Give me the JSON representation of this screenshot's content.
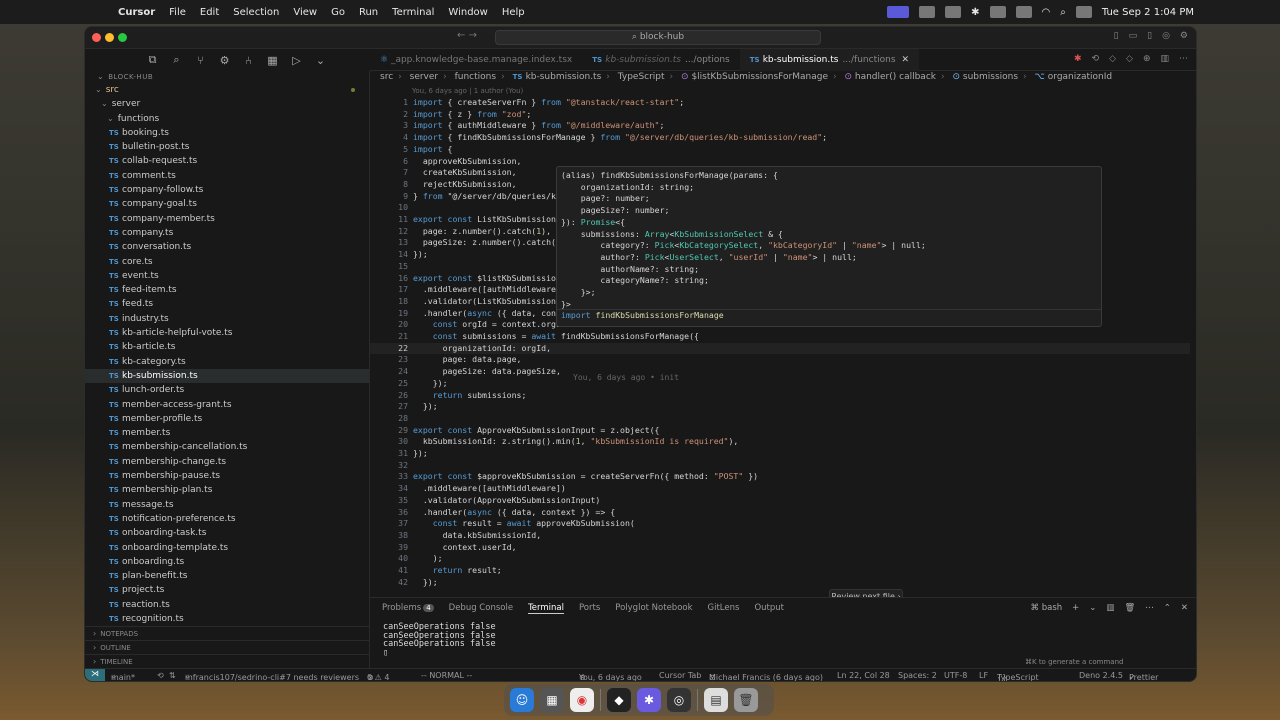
{
  "menubar": {
    "app": "Cursor",
    "items": [
      "File",
      "Edit",
      "Selection",
      "View",
      "Go",
      "Run",
      "Terminal",
      "Window",
      "Help"
    ],
    "datetime": "Tue Sep 2  1:04 PM"
  },
  "window": {
    "search": "block-hub"
  },
  "explorer": {
    "section": "BLOCK-HUB",
    "folder_src": "src",
    "folder_server": "server",
    "folder_functions": "functions",
    "files": [
      "booking.ts",
      "bulletin-post.ts",
      "collab-request.ts",
      "comment.ts",
      "company-follow.ts",
      "company-goal.ts",
      "company-member.ts",
      "company.ts",
      "conversation.ts",
      "core.ts",
      "event.ts",
      "feed-item.ts",
      "feed.ts",
      "industry.ts",
      "kb-article-helpful-vote.ts",
      "kb-article.ts",
      "kb-category.ts",
      "kb-submission.ts",
      "lunch-order.ts",
      "member-access-grant.ts",
      "member-profile.ts",
      "member.ts",
      "membership-cancellation.ts",
      "membership-change.ts",
      "membership-pause.ts",
      "membership-plan.ts",
      "message.ts",
      "notification-preference.ts",
      "onboarding-task.ts",
      "onboarding-template.ts",
      "onboarding.ts",
      "plan-benefit.ts",
      "project.ts",
      "reaction.ts",
      "recognition.ts"
    ],
    "selected": "kb-submission.ts",
    "notepads": "NOTEPADS",
    "outline": "OUTLINE",
    "timeline": "TIMELINE"
  },
  "tabs": [
    {
      "label": "_app.knowledge-base.manage.index.tsx",
      "sub": "",
      "active": false
    },
    {
      "label": "kb-submission.ts",
      "sub": ".../options",
      "active": false
    },
    {
      "label": "kb-submission.ts",
      "sub": ".../functions",
      "active": true
    }
  ],
  "breadcrumb": [
    "src",
    "server",
    "functions",
    "kb-submission.ts",
    "TypeScript",
    "$listKbSubmissionsForManage",
    "handler() callback",
    "submissions",
    "organizationId"
  ],
  "blame_top": "You, 6 days ago | 1 author (You)",
  "code": [
    {
      "n": "1",
      "t": "import { createServerFn } from \"@tanstack/react-start\";"
    },
    {
      "n": "2",
      "t": "import { z } from \"zod\";"
    },
    {
      "n": "3",
      "t": "import { authMiddleware } from \"@/middleware/auth\";"
    },
    {
      "n": "4",
      "t": "import { findKbSubmissionsForManage } from \"@/server/db/queries/kb-submission/read\";"
    },
    {
      "n": "5",
      "t": "import {"
    },
    {
      "n": "6",
      "t": "  approveKbSubmission,"
    },
    {
      "n": "7",
      "t": "  createKbSubmission,"
    },
    {
      "n": "8",
      "t": "  rejectKbSubmission,"
    },
    {
      "n": "9",
      "t": "} from \"@/server/db/queries/kb"
    },
    {
      "n": "10",
      "t": ""
    },
    {
      "n": "11",
      "t": "export const ListKbSubmissions"
    },
    {
      "n": "12",
      "t": "  page: z.number().catch(1),"
    },
    {
      "n": "13",
      "t": "  pageSize: z.number().catch(5"
    },
    {
      "n": "14",
      "t": "});"
    },
    {
      "n": "15",
      "t": ""
    },
    {
      "n": "16",
      "t": "export const $listKbSubmission"
    },
    {
      "n": "17",
      "t": "  .middleware([authMiddleware]"
    },
    {
      "n": "18",
      "t": "  .validator(ListKbSubmissions"
    },
    {
      "n": "19",
      "t": "  .handler(async ({ data, cont"
    },
    {
      "n": "20",
      "t": "    const orgId = context.orgI"
    },
    {
      "n": "21",
      "t": "    const submissions = await findKbSubmissionsForManage({"
    },
    {
      "n": "22",
      "t": "      organizationId: orgId,"
    },
    {
      "n": "23",
      "t": "      page: data.page,"
    },
    {
      "n": "24",
      "t": "      pageSize: data.pageSize,"
    },
    {
      "n": "25",
      "t": "    });"
    },
    {
      "n": "26",
      "t": "    return submissions;"
    },
    {
      "n": "27",
      "t": "  });"
    },
    {
      "n": "28",
      "t": ""
    },
    {
      "n": "29",
      "t": "export const ApproveKbSubmissionInput = z.object({"
    },
    {
      "n": "30",
      "t": "  kbSubmissionId: z.string().min(1, \"kbSubmissionId is required\"),"
    },
    {
      "n": "31",
      "t": "});"
    },
    {
      "n": "32",
      "t": ""
    },
    {
      "n": "33",
      "t": "export const $approveKbSubmission = createServerFn({ method: \"POST\" })"
    },
    {
      "n": "34",
      "t": "  .middleware([authMiddleware])"
    },
    {
      "n": "35",
      "t": "  .validator(ApproveKbSubmissionInput)"
    },
    {
      "n": "36",
      "t": "  .handler(async ({ data, context }) => {"
    },
    {
      "n": "37",
      "t": "    const result = await approveKbSubmission("
    },
    {
      "n": "38",
      "t": "      data.kbSubmissionId,"
    },
    {
      "n": "39",
      "t": "      context.userId,"
    },
    {
      "n": "40",
      "t": "    );"
    },
    {
      "n": "41",
      "t": "    return result;"
    },
    {
      "n": "42",
      "t": "  });"
    }
  ],
  "current_line": "22",
  "inline_blame": "You, 6 days ago • init",
  "hover": {
    "lines": [
      "(alias) findKbSubmissionsForManage(params: {",
      "    organizationId: string;",
      "    page?: number;",
      "    pageSize?: number;",
      "}): Promise<{",
      "    submissions: Array<KbSubmissionSelect & {",
      "        category?: Pick<KbCategorySelect, \"kbCategoryId\" | \"name\"> | null;",
      "        author?: Pick<UserSelect, \"userId\" | \"name\"> | null;",
      "        authorName?: string;",
      "        categoryName?: string;",
      "    }>;",
      "}>"
    ],
    "import_line": "import findKbSubmissionsForManage"
  },
  "review_button": "Review next file",
  "panel": {
    "tabs": [
      "Problems",
      "Debug Console",
      "Terminal",
      "Ports",
      "Polyglot Notebook",
      "GitLens",
      "Output"
    ],
    "problems_count": "4",
    "active": "Terminal",
    "shell": "bash",
    "output": [
      "canSeeOperations false",
      "canSeeOperations false",
      "canSeeOperations false"
    ],
    "hint": "⌘K to generate a command"
  },
  "status": {
    "branch": "main*",
    "pr": "mfrancis107/sedrino-cli#7 needs reviewers",
    "diagnostics": "0 ⚠ 4",
    "mode": "-- NORMAL --",
    "blame": "You, 6 days ago",
    "cursor_tab": "Cursor Tab",
    "author_blame": "Michael Francis (6 days ago)",
    "position": "Ln 22, Col 28",
    "spaces": "Spaces: 2",
    "encoding": "UTF-8",
    "eol": "LF",
    "language": "TypeScript",
    "runtime": "Deno 2.4.5",
    "formatter": "Prettier"
  },
  "colors": {
    "accent": "#2b6d78",
    "ts_icon": "#4e94ce"
  }
}
